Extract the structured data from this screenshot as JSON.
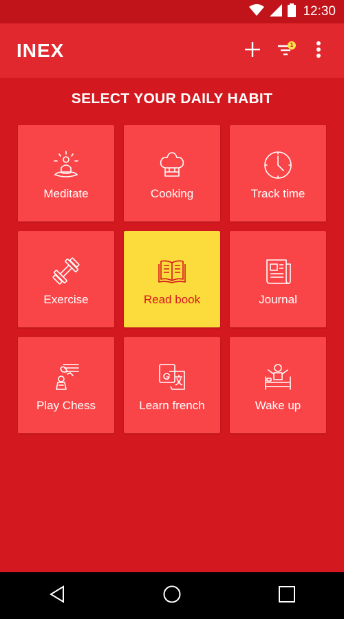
{
  "status_bar": {
    "time": "12:30"
  },
  "app_bar": {
    "logo": "INEX",
    "filter_badge": "1",
    "actions": [
      "plus-icon",
      "filter-icon",
      "more-vert-icon"
    ]
  },
  "page": {
    "title": "SELECT YOUR DAILY HABIT"
  },
  "habits": [
    {
      "label": "Meditate",
      "icon": "meditate-icon",
      "selected": false
    },
    {
      "label": "Cooking",
      "icon": "chef-hat-icon",
      "selected": false
    },
    {
      "label": "Track time",
      "icon": "clock-icon",
      "selected": false
    },
    {
      "label": "Exercise",
      "icon": "dumbbell-icon",
      "selected": false
    },
    {
      "label": "Read book",
      "icon": "open-book-icon",
      "selected": true
    },
    {
      "label": "Journal",
      "icon": "newspaper-icon",
      "selected": false
    },
    {
      "label": "Play Chess",
      "icon": "chess-icon",
      "selected": false
    },
    {
      "label": "Learn french",
      "icon": "translate-icon",
      "selected": false
    },
    {
      "label": "Wake up",
      "icon": "wake-up-icon",
      "selected": false
    }
  ],
  "colors": {
    "background": "#d3191f",
    "app_bar": "#e1282e",
    "tile": "#fa4548",
    "tile_selected": "#fcdb3c"
  }
}
